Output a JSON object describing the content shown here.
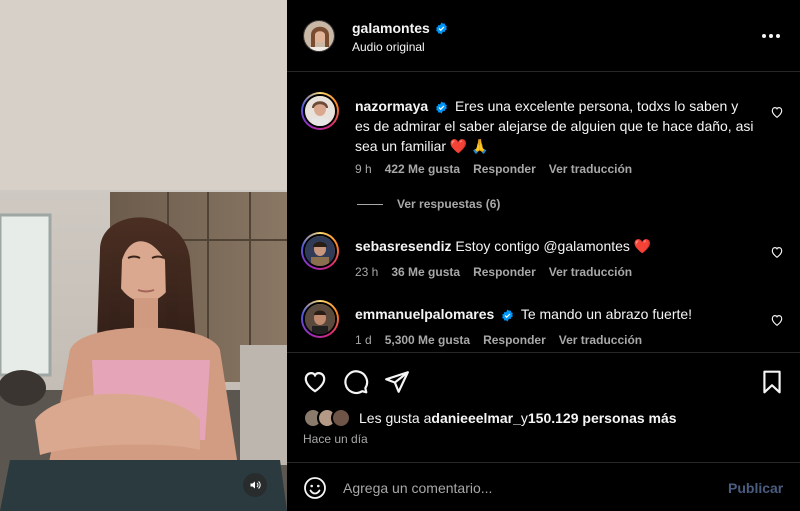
{
  "post": {
    "author": "galamontes",
    "audio": "Audio original"
  },
  "comments": [
    {
      "user": "nazormaya",
      "verified": true,
      "text": "Eres una excelente persona, todxs lo saben y es de admirar el saber alejarse de alguien que te hace daño, asi sea un familiar ❤️ 🙏",
      "age": "9 h",
      "likes": "422 Me gusta",
      "reply": "Responder",
      "translate": "Ver traducción",
      "view_replies": "Ver respuestas (6)"
    },
    {
      "user": "sebasresendiz",
      "verified": false,
      "text": "Estoy contigo @galamontes ❤️",
      "age": "23 h",
      "likes": "36 Me gusta",
      "reply": "Responder",
      "translate": "Ver traducción"
    },
    {
      "user": "emmanuelpalomares",
      "verified": true,
      "text": "Te mando un abrazo fuerte!",
      "age": "1 d",
      "likes": "5,300 Me gusta",
      "reply": "Responder",
      "translate": "Ver traducción"
    }
  ],
  "likes_line": {
    "prefix": "Les gusta a ",
    "user": "danieeelmar_",
    "middle": " y ",
    "others": "150.129 personas más"
  },
  "posted_ago": "Hace un día",
  "composer": {
    "placeholder": "Agrega un comentario...",
    "publish": "Publicar"
  },
  "colors": {
    "background": "#000000",
    "secondary_text": "#a8a8a8",
    "verified": "#0095f6",
    "publish_disabled": "#4a5d80"
  },
  "icons": [
    "speaker-icon",
    "more-icon",
    "verified-icon",
    "heart-icon",
    "comment-icon",
    "share-icon",
    "bookmark-icon",
    "emoji-icon"
  ]
}
